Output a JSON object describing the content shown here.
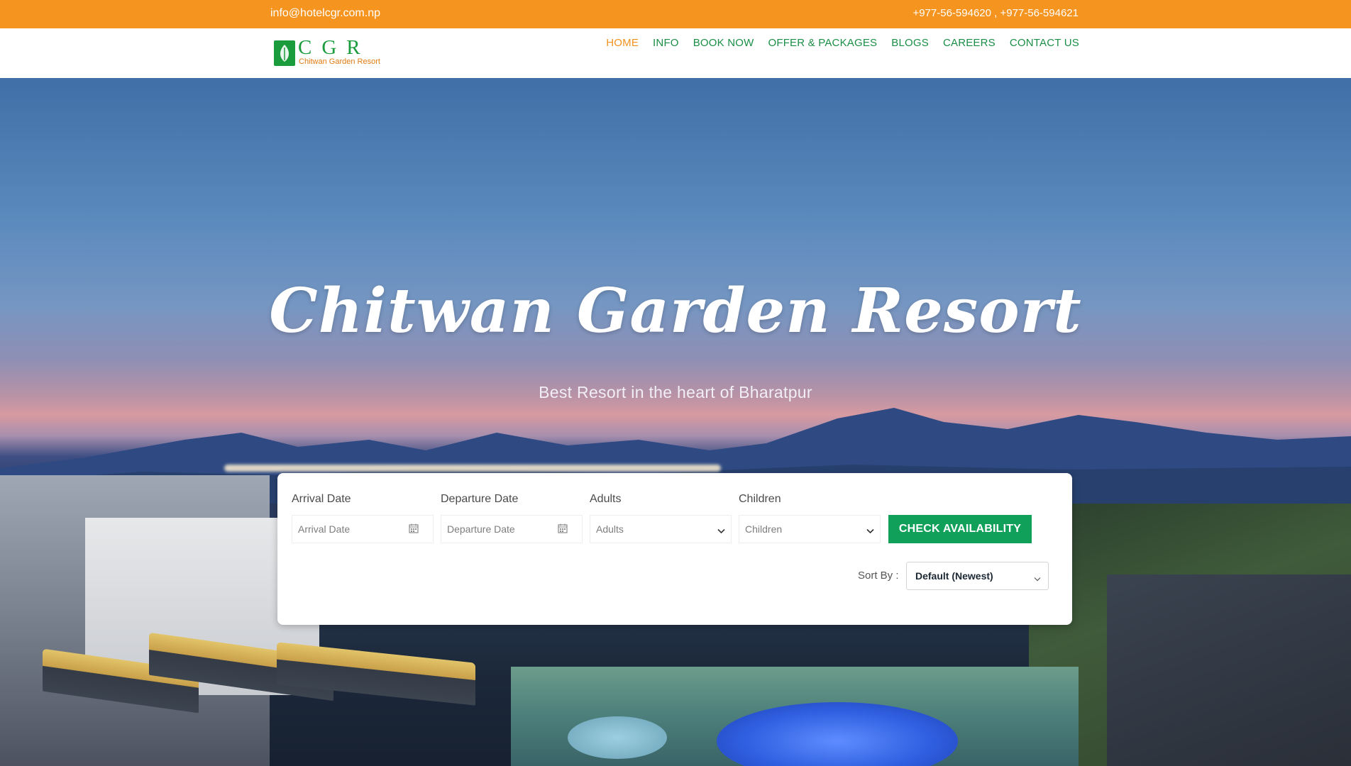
{
  "topbar": {
    "email": "info@hotelcgr.com.np",
    "phone": "+977-56-594620 , +977-56-594621"
  },
  "logo": {
    "letters": "CGR",
    "subtitle": "Chitwan Garden Resort"
  },
  "nav": {
    "items": [
      {
        "label": "HOME",
        "active": true
      },
      {
        "label": "INFO",
        "active": false
      },
      {
        "label": "BOOK NOW",
        "active": false
      },
      {
        "label": "OFFER & PACKAGES",
        "active": false
      },
      {
        "label": "BLOGS",
        "active": false
      },
      {
        "label": "CAREERS",
        "active": false
      },
      {
        "label": "CONTACT US",
        "active": false
      }
    ]
  },
  "hero": {
    "title": "Chitwan Garden Resort",
    "subtitle": "Best Resort in the heart of Bharatpur"
  },
  "booking": {
    "arrival": {
      "label": "Arrival Date",
      "placeholder": "Arrival Date",
      "icon": "calendar-icon"
    },
    "departure": {
      "label": "Departure Date",
      "placeholder": "Departure Date",
      "icon": "calendar-icon"
    },
    "adults": {
      "label": "Adults",
      "placeholder": "Adults"
    },
    "children": {
      "label": "Children",
      "placeholder": "Children"
    },
    "check_button": "CHECK AVAILABILITY",
    "sort_label": "Sort By :",
    "sort_value": "Default (Newest)"
  },
  "colors": {
    "topbar": "#f5941f",
    "brand_green": "#1a9b3c",
    "button_green": "#10a05a",
    "nav_active": "#f0921e"
  }
}
